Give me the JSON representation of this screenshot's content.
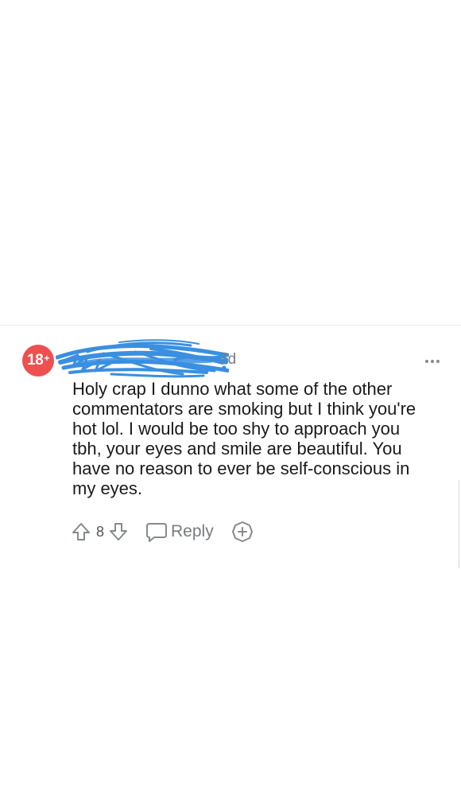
{
  "comment": {
    "avatar_label": "18",
    "avatar_badge": "+",
    "age": "7d",
    "body": "Holy crap I dunno what some of the other commentators are smoking but I think you're hot lol. I would be too shy to approach you tbh, your eyes and smile are beautiful. You have no reason to ever be self-conscious in my eyes.",
    "upvote_count": "8",
    "reply_label": "Reply",
    "icons": {
      "more": "more-horizontal-icon",
      "upvote": "arrow-up-icon",
      "downvote": "arrow-down-icon",
      "reply": "speech-bubble-icon",
      "award": "award-add-icon"
    }
  },
  "colors": {
    "avatar_bg": "#ee5050",
    "scribble": "#3a8fe0",
    "icon_gray": "#878a8c",
    "text": "#1a1a1b",
    "meta_text": "#7c7c7c"
  }
}
